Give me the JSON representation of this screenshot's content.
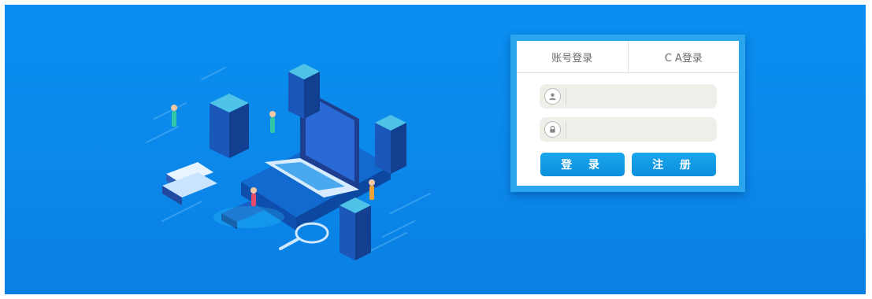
{
  "login": {
    "tabs": [
      {
        "label": "账号登录"
      },
      {
        "label": "C A登录"
      }
    ],
    "username": {
      "value": "",
      "placeholder": "",
      "icon": "user-icon"
    },
    "password": {
      "value": "",
      "placeholder": "",
      "icon": "lock-icon"
    },
    "buttons": {
      "login_label": "登 录",
      "register_label": "注 册"
    }
  },
  "colors": {
    "background": "#0b88ea",
    "panel_border": "#2aa6ee",
    "button": "#0c8fdc",
    "input_bg": "#efeee9"
  }
}
